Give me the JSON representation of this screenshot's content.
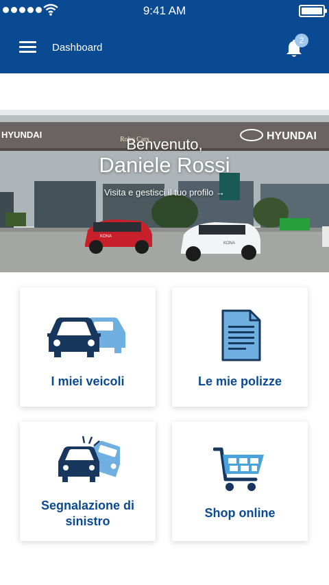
{
  "status_bar": {
    "time": "9:41 AM"
  },
  "header": {
    "title": "Dashboard",
    "notification_count": "2"
  },
  "hero": {
    "welcome": "Benvenuto,",
    "user_name": "Daniele Rossi",
    "profile_link": "Visita e gestisci il tuo profilo",
    "profile_arrow": "→",
    "sign_left": "HYUNDAI",
    "sign_right": "HYUNDAI",
    "dealer": "Roby Cars",
    "car_model": "KONA"
  },
  "tiles": [
    {
      "label": "I miei veicoli",
      "icon": "cars-icon"
    },
    {
      "label": "Le mie polizze",
      "icon": "document-icon"
    },
    {
      "label": "Segnalazione di sinistro",
      "icon": "car-crash-icon"
    },
    {
      "label": "Shop online",
      "icon": "shopping-cart-icon"
    }
  ],
  "colors": {
    "header": "#0a4a92",
    "accent_light": "#6fb0e0",
    "dark": "#17375e"
  }
}
